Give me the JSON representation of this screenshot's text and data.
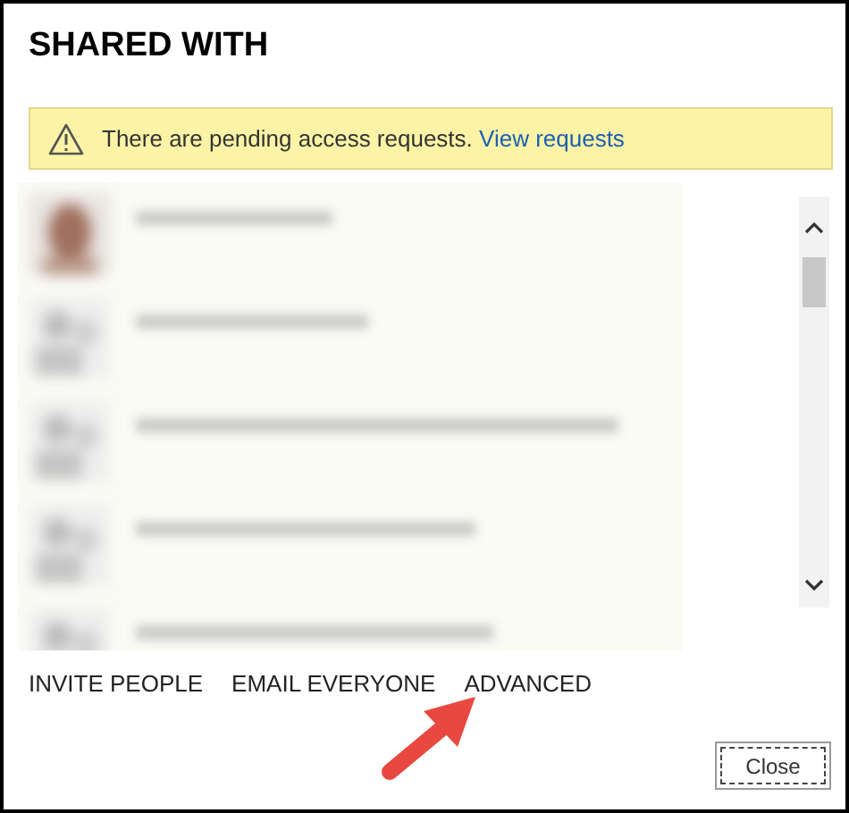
{
  "dialog": {
    "title": "SHARED WITH"
  },
  "banner": {
    "message": "There are pending access requests.",
    "link": "View requests"
  },
  "shared_list": [
    {
      "kind": "photo"
    },
    {
      "kind": "silhouette"
    },
    {
      "kind": "silhouette"
    },
    {
      "kind": "silhouette"
    },
    {
      "kind": "silhouette"
    }
  ],
  "actions": [
    "INVITE PEOPLE",
    "EMAIL EVERYONE",
    "ADVANCED"
  ],
  "buttons": [
    "Close"
  ]
}
